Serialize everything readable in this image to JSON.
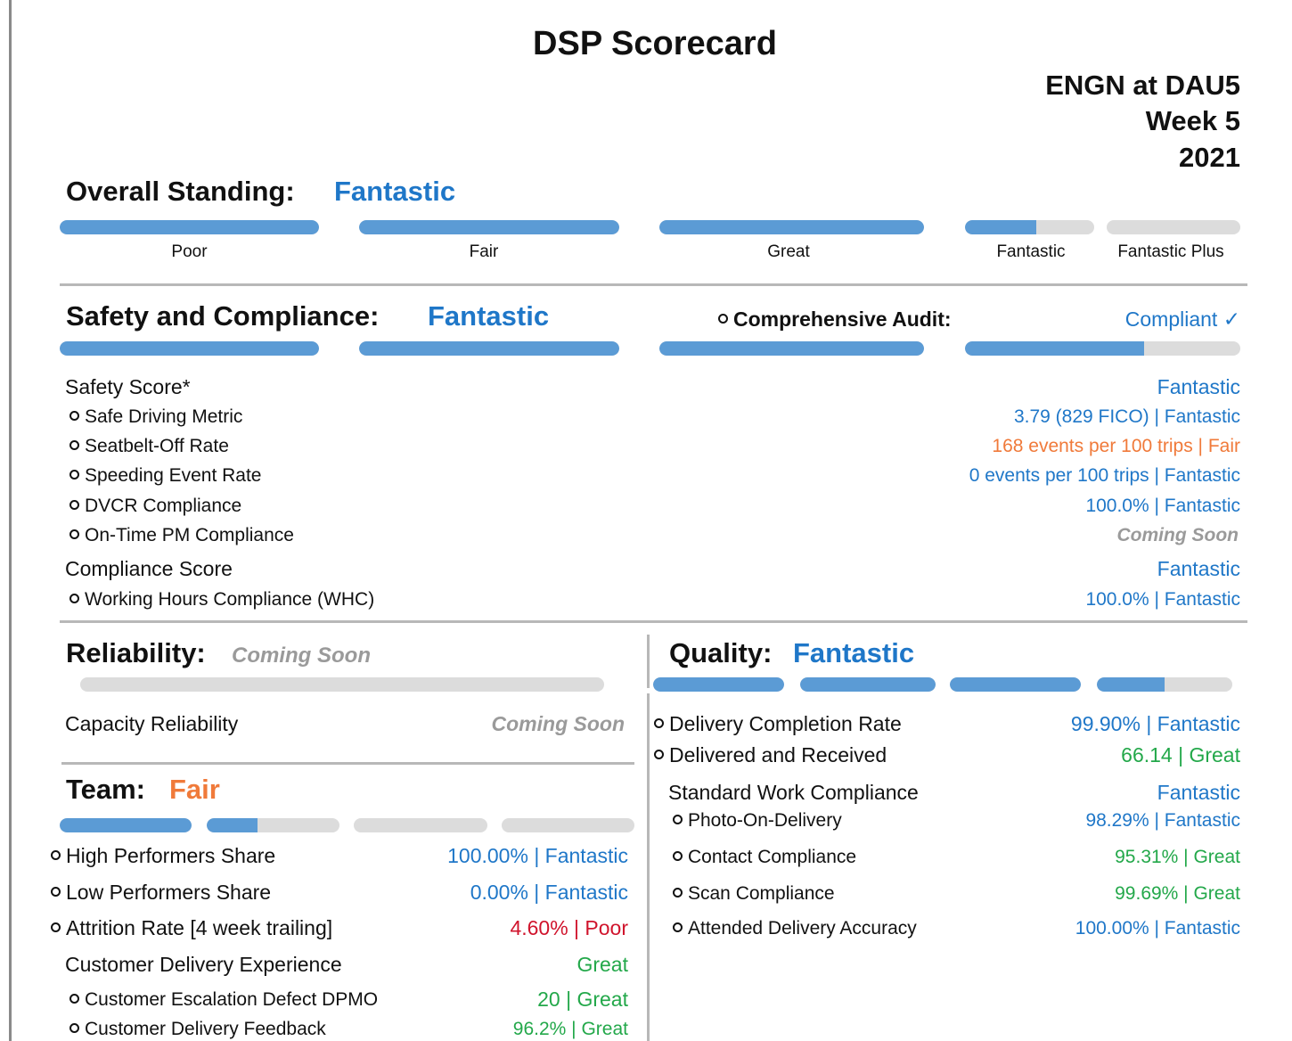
{
  "title": "DSP Scorecard",
  "header": {
    "line1": "ENGN at DAU5",
    "line2": "Week 5",
    "line3": "2021"
  },
  "colors": {
    "bar_fill": "#5b9bd5",
    "bar_track": "#dcdcdc",
    "fantastic": "#1f77c8",
    "great": "#23a84a",
    "fair": "#f07a3a",
    "poor": "#d0142c"
  },
  "overall": {
    "label": "Overall Standing:",
    "status": "Fantastic",
    "levels": [
      "Poor",
      "Fair",
      "Great",
      "Fantastic",
      "Fantastic Plus"
    ],
    "segment_fill": [
      1,
      1,
      1,
      0.55,
      0
    ]
  },
  "safety": {
    "label": "Safety and Compliance:",
    "status": "Fantastic",
    "audit_label": "Comprehensive Audit:",
    "audit_value": "Compliant ✓",
    "segment_fill": [
      1,
      1,
      1,
      0.65
    ],
    "safety_score": {
      "label": "Safety Score*",
      "value": "Fantastic"
    },
    "metrics": [
      {
        "label": "Safe Driving Metric",
        "value": "3.79 (829 FICO) | Fantastic"
      },
      {
        "label": "Seatbelt-Off Rate",
        "value": "168 events per 100 trips | Fair"
      },
      {
        "label": "Speeding Event Rate",
        "value": "0 events per 100 trips | Fantastic"
      },
      {
        "label": "DVCR Compliance",
        "value": "100.0% | Fantastic"
      },
      {
        "label": "On-Time PM Compliance",
        "value": "Coming Soon"
      }
    ],
    "compliance_score": {
      "label": "Compliance Score",
      "value": "Fantastic"
    },
    "whc": {
      "label": "Working Hours Compliance (WHC)",
      "value": "100.0% | Fantastic"
    }
  },
  "reliability": {
    "label": "Reliability:",
    "status": "Coming Soon",
    "capacity_label": "Capacity Reliability",
    "capacity_value": "Coming Soon"
  },
  "quality": {
    "label": "Quality:",
    "status": "Fantastic",
    "segment_fill": [
      1,
      1,
      1,
      0.5
    ],
    "dcr": {
      "label": "Delivery Completion Rate",
      "value": "99.90% | Fantastic"
    },
    "dar": {
      "label": "Delivered and Received",
      "value": "66.14 | Great"
    },
    "swc": {
      "label": "Standard Work Compliance",
      "value": "Fantastic"
    },
    "swc_items": [
      {
        "label": "Photo-On-Delivery",
        "value": "98.29% | Fantastic"
      },
      {
        "label": "Contact Compliance",
        "value": "95.31% | Great"
      },
      {
        "label": "Scan Compliance",
        "value": "99.69% | Great"
      },
      {
        "label": "Attended Delivery Accuracy",
        "value": "100.00% | Fantastic"
      }
    ]
  },
  "team": {
    "label": "Team:",
    "status": "Fair",
    "segment_fill": [
      1,
      0.38,
      0,
      0
    ],
    "metrics": [
      {
        "label": "High Performers Share",
        "value": "100.00% | Fantastic"
      },
      {
        "label": "Low Performers Share",
        "value": "0.00% | Fantastic"
      },
      {
        "label": "Attrition Rate [4 week trailing]",
        "value": "4.60% | Poor"
      }
    ],
    "cde": {
      "label": "Customer Delivery Experience",
      "value": "Great"
    },
    "cde_items": [
      {
        "label": "Customer Escalation Defect DPMO",
        "value": "20 | Great"
      },
      {
        "label": "Customer Delivery Feedback",
        "value": "96.2% | Great"
      }
    ]
  }
}
